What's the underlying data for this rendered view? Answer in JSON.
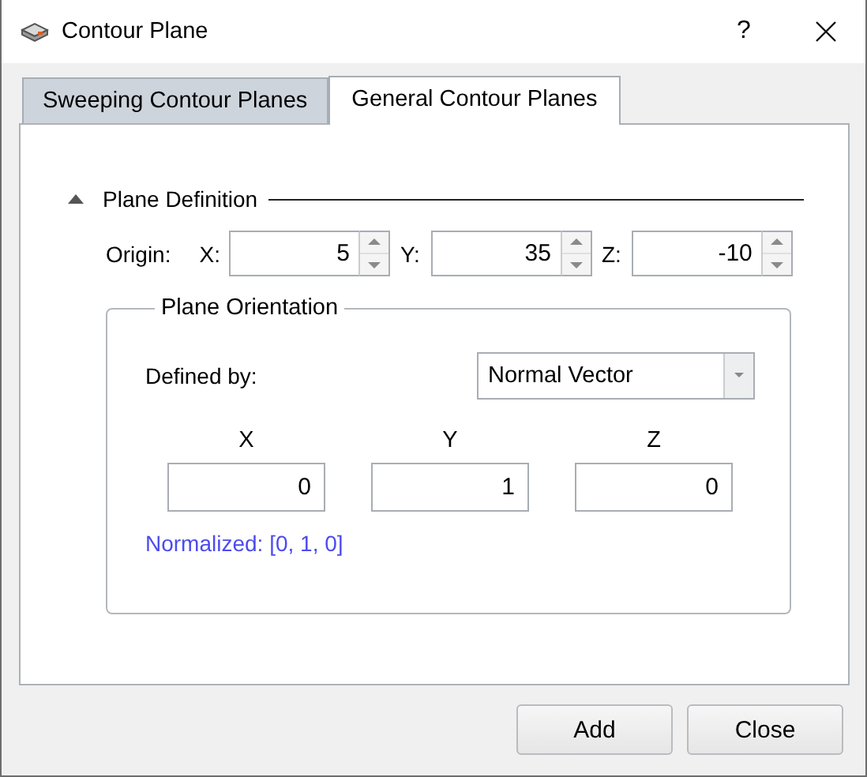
{
  "window": {
    "title": "Contour Plane",
    "help": "?"
  },
  "tabs": [
    {
      "label": "Sweeping Contour Planes",
      "selected": false
    },
    {
      "label": "General Contour Planes",
      "selected": true
    }
  ],
  "plane_definition": {
    "title": "Plane Definition",
    "expanded": true,
    "origin_label": "Origin:",
    "origin": [
      {
        "axis": "X:",
        "value": "5"
      },
      {
        "axis": "Y:",
        "value": "35"
      },
      {
        "axis": "Z:",
        "value": "-10"
      }
    ]
  },
  "plane_orientation": {
    "title": "Plane Orientation",
    "defined_by_label": "Defined by:",
    "defined_by": "Normal Vector",
    "vector": [
      {
        "axis": "X",
        "value": "0"
      },
      {
        "axis": "Y",
        "value": "1"
      },
      {
        "axis": "Z",
        "value": "0"
      }
    ],
    "normalized": "Normalized: [0, 1, 0]"
  },
  "buttons": [
    "Add",
    "Close"
  ]
}
